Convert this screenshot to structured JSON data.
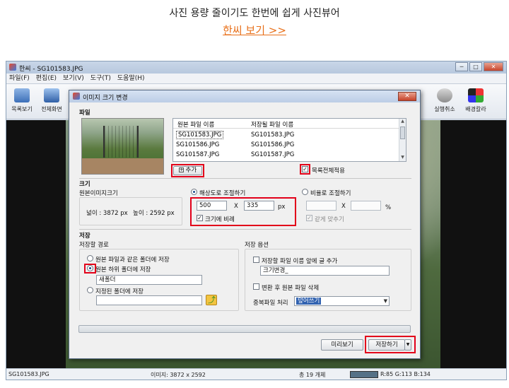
{
  "promo": {
    "title": "사진 용량 줄이기도 한번에 쉽게 사진뷰어",
    "link": "한씨 보기 >>"
  },
  "app": {
    "title": "한씨 - SG101583.JPG",
    "window_buttons": [
      "─",
      "□",
      "✕"
    ],
    "menu": [
      "파일(F)",
      "편집(E)",
      "보기(V)",
      "도구(T)",
      "도움말(H)"
    ],
    "toolbar": {
      "list_view": "목록보기",
      "fullscreen": "전체화면",
      "undo": "실행취소",
      "bg_color": "배경칼라"
    },
    "statusbar": {
      "filename": "SG101583.JPG",
      "image_size": "이미지: 3872 x 2592",
      "count": "총 19 개체",
      "rgb": "R:85 G:113 B:134"
    }
  },
  "dialog": {
    "title": "이미지 크기 변경",
    "close": "✕",
    "file_section": "파일",
    "columns": {
      "original": "원본 파일 이름",
      "saved": "저장될 파일 이름"
    },
    "files": [
      {
        "original": "SG101583.JPG",
        "saved": "SG101583.JPG"
      },
      {
        "original": "SG101586.JPG",
        "saved": "SG101586.JPG"
      },
      {
        "original": "SG101587.JPG",
        "saved": "SG101587.JPG"
      }
    ],
    "add_button": "추가",
    "apply_all": "목록전체적용",
    "size_section": "크기",
    "original_size_label": "원본이미지크기",
    "width_text": "넓이 :   3872 px",
    "height_text": "높이 :  2592 px",
    "by_resolution": "해상도로 조절하기",
    "by_ratio": "비율로 조절하기",
    "width_value": "500",
    "x_sep": "X",
    "height_value": "335",
    "unit_px": "px",
    "keep_ratio": "크기에 비례",
    "ratio_x_sep": "X",
    "unit_pct": "%",
    "same_fit": "같게 맞추기",
    "save_section": "저장",
    "save_path_label": "저장할 경로",
    "same_folder": "원본 파일과 같은 폴더에 저장",
    "sub_folder": "원본 하위 폴더에 저장",
    "sub_folder_value": "새폴더",
    "specified_folder": "지정된 폴더에 저장",
    "save_options_label": "저장 옵션",
    "prefix_option": "저장할 파일 이름 앞에 글 추가",
    "prefix_value": "크기변경_",
    "delete_original": "변환 후 원본 파일 삭제",
    "duplicate_label": "중복파일 처리",
    "duplicate_value": "덮어쓰기",
    "preview_button": "미리보기",
    "save_button": "저장하기",
    "save_arrow": "▼"
  },
  "colors": {
    "highlight_red": "#e2001a",
    "link_orange": "#e8701a"
  }
}
